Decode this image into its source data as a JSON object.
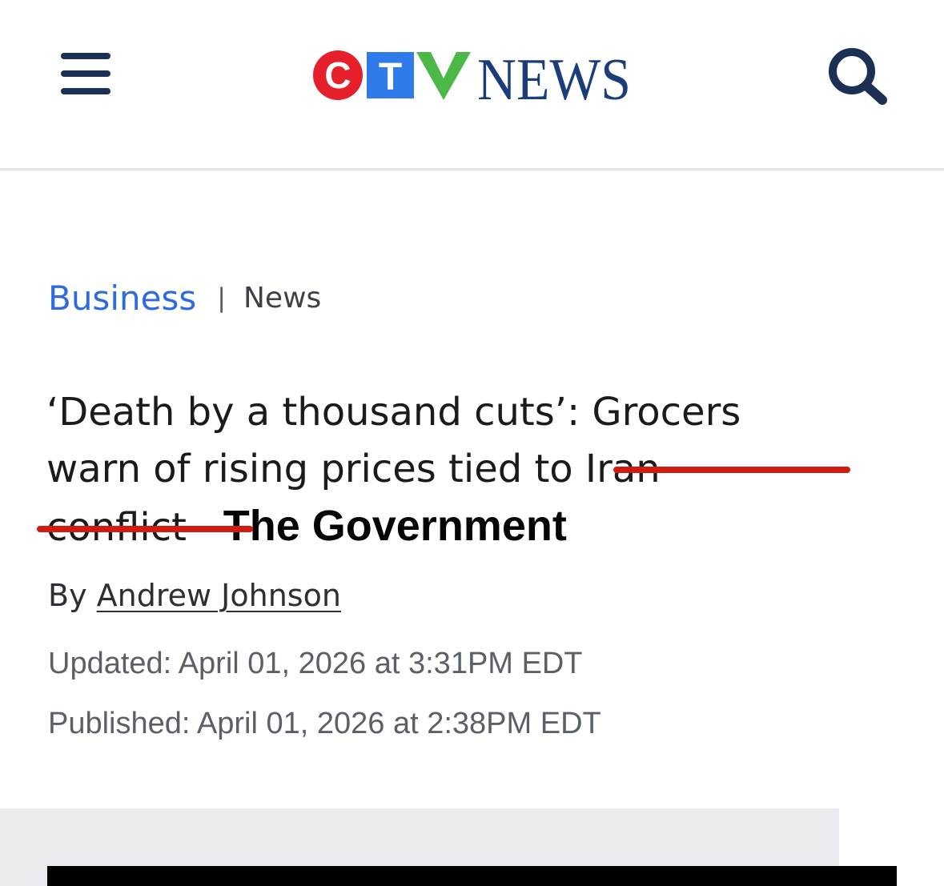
{
  "header": {
    "menu_icon": "hamburger-menu-icon",
    "logo": {
      "letters": [
        "C",
        "T",
        "V"
      ],
      "wordmark": "NEWS",
      "colors": {
        "c_red": "#e5202a",
        "t_blue": "#2f7bea",
        "v_green": "#4cb847",
        "wordmark_navy": "#1b3d7a"
      }
    },
    "search_icon": "search-icon"
  },
  "breadcrumb": {
    "primary": "Business",
    "separator": "|",
    "secondary": "News"
  },
  "article": {
    "headline_line1": "‘Death by a thousand cuts’: Grocers",
    "headline_line2_prefix": "warn of rising prices tied to",
    "headline_struck_1": "Iran",
    "headline_struck_2": "conflict",
    "headline_replacement": "The Government",
    "byline_prefix": "By",
    "author": "Andrew Johnson",
    "updated": "Updated: April 01, 2026 at 3:31PM EDT",
    "published": "Published: April 01, 2026 at 2:38PM EDT"
  },
  "colors": {
    "brand_navy": "#1c3055",
    "link_blue": "#2e6ae0",
    "strike_red": "#d21b0f",
    "divider": "#e3e4e6",
    "media_bg": "#e9ebee"
  }
}
